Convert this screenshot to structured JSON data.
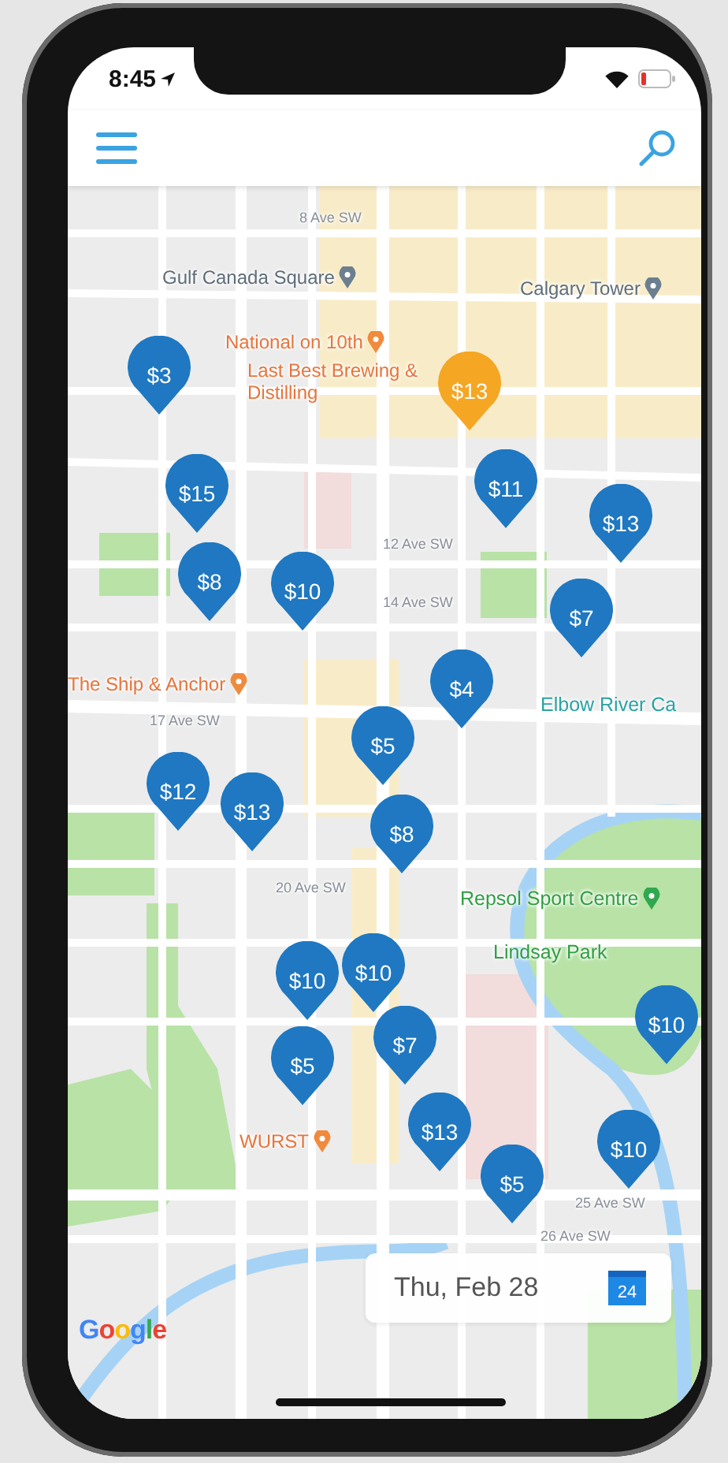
{
  "status_bar": {
    "time": "8:45"
  },
  "map": {
    "labels": [
      {
        "text": "8 Ave SW",
        "kind": "street"
      },
      {
        "text": "Gulf Canada Square",
        "kind": "landmark"
      },
      {
        "text": "Calgary Tower",
        "kind": "landmark"
      },
      {
        "text": "National on 10th",
        "kind": "food"
      },
      {
        "text": "Last Best Brewing & Distilling",
        "kind": "food"
      },
      {
        "text": "12 Ave SW",
        "kind": "street"
      },
      {
        "text": "14 Ave SW",
        "kind": "street"
      },
      {
        "text": "The Ship & Anchor",
        "kind": "food"
      },
      {
        "text": "17 Ave SW",
        "kind": "street"
      },
      {
        "text": "Elbow River Ca",
        "kind": "water"
      },
      {
        "text": "20 Ave SW",
        "kind": "street"
      },
      {
        "text": "Repsol Sport Centre",
        "kind": "park-place"
      },
      {
        "text": "Lindsay Park",
        "kind": "park"
      },
      {
        "text": "WURST",
        "kind": "food"
      },
      {
        "text": "25 Ave SW",
        "kind": "street"
      },
      {
        "text": "26 Ave SW",
        "kind": "street"
      }
    ],
    "pins": [
      {
        "price": "$3",
        "selected": false
      },
      {
        "price": "$13",
        "selected": true
      },
      {
        "price": "$15",
        "selected": false
      },
      {
        "price": "$11",
        "selected": false
      },
      {
        "price": "$13",
        "selected": false
      },
      {
        "price": "$8",
        "selected": false
      },
      {
        "price": "$10",
        "selected": false
      },
      {
        "price": "$7",
        "selected": false
      },
      {
        "price": "$4",
        "selected": false
      },
      {
        "price": "$5",
        "selected": false
      },
      {
        "price": "$12",
        "selected": false
      },
      {
        "price": "$13",
        "selected": false
      },
      {
        "price": "$8",
        "selected": false
      },
      {
        "price": "$10",
        "selected": false
      },
      {
        "price": "$10",
        "selected": false
      },
      {
        "price": "$5",
        "selected": false
      },
      {
        "price": "$7",
        "selected": false
      },
      {
        "price": "$10",
        "selected": false
      },
      {
        "price": "$13",
        "selected": false
      },
      {
        "price": "$5",
        "selected": false
      },
      {
        "price": "$10",
        "selected": false
      }
    ],
    "attribution": "Google",
    "date_picker": {
      "date": "Thu, Feb 28",
      "calendar_day": "24"
    }
  }
}
